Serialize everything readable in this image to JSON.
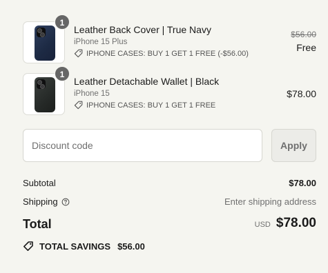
{
  "items": [
    {
      "quantity": "1",
      "name": "Leather Back Cover | True Navy",
      "variant": "iPhone 15 Plus",
      "discount": "IPHONE CASES: BUY 1 GET 1 FREE (-$56.00)",
      "original_price": "$56.00",
      "price": "Free",
      "color": "#22304d"
    },
    {
      "quantity": "1",
      "name": "Leather Detachable Wallet | Black",
      "variant": "iPhone 15",
      "discount": "IPHONE CASES: BUY 1 GET 1 FREE",
      "price": "$78.00",
      "color": "#2a2e2c"
    }
  ],
  "discount_code": {
    "placeholder": "Discount code",
    "value": "",
    "apply_label": "Apply"
  },
  "summary": {
    "subtotal_label": "Subtotal",
    "subtotal_value": "$78.00",
    "shipping_label": "Shipping",
    "shipping_value": "Enter shipping address",
    "total_label": "Total",
    "currency": "USD",
    "total_value": "$78.00"
  },
  "savings": {
    "label": "TOTAL SAVINGS",
    "value": "$56.00"
  },
  "icons": {
    "tag": "tag-icon",
    "help": "help-circle-icon",
    "savings": "savings-tag-icon"
  }
}
